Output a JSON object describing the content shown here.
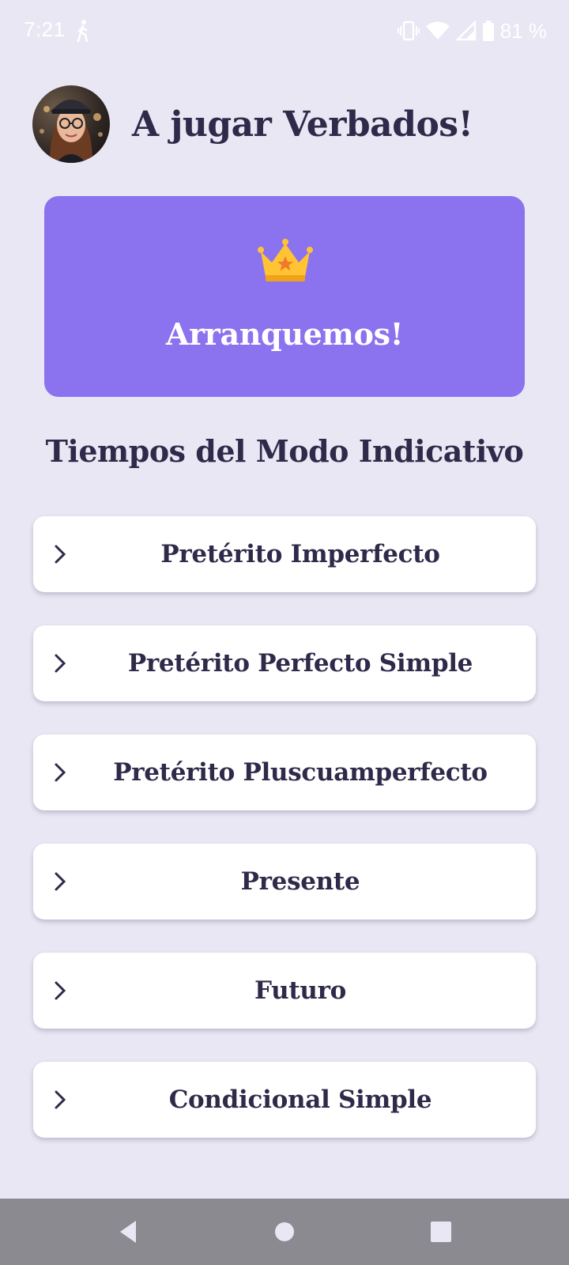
{
  "status_bar": {
    "time": "7:21",
    "battery": "81 %",
    "icons": [
      "walk-icon",
      "vibrate-icon",
      "wifi-icon",
      "signal-icon",
      "battery-icon"
    ]
  },
  "header": {
    "title": "A jugar Verbados!",
    "avatar": "avatar-girl-with-glasses-and-cap"
  },
  "start_card": {
    "icon": "crown-icon",
    "label": "Arranquemos!",
    "color": "#8b72ee"
  },
  "section": {
    "title": "Tiempos del Modo Indicativo"
  },
  "tenses": [
    {
      "label": "Pretérito Imperfecto"
    },
    {
      "label": "Pretérito Perfecto Simple"
    },
    {
      "label": "Pretérito Pluscuamperfecto"
    },
    {
      "label": "Presente"
    },
    {
      "label": "Futuro"
    },
    {
      "label": "Condicional Simple"
    }
  ],
  "nav_bar": {
    "buttons": [
      "back-icon",
      "home-icon",
      "recents-icon"
    ]
  },
  "colors": {
    "background": "#e9e7f3",
    "text": "#2f2a4a",
    "accent": "#8b72ee",
    "nav": "#8b8a90"
  }
}
